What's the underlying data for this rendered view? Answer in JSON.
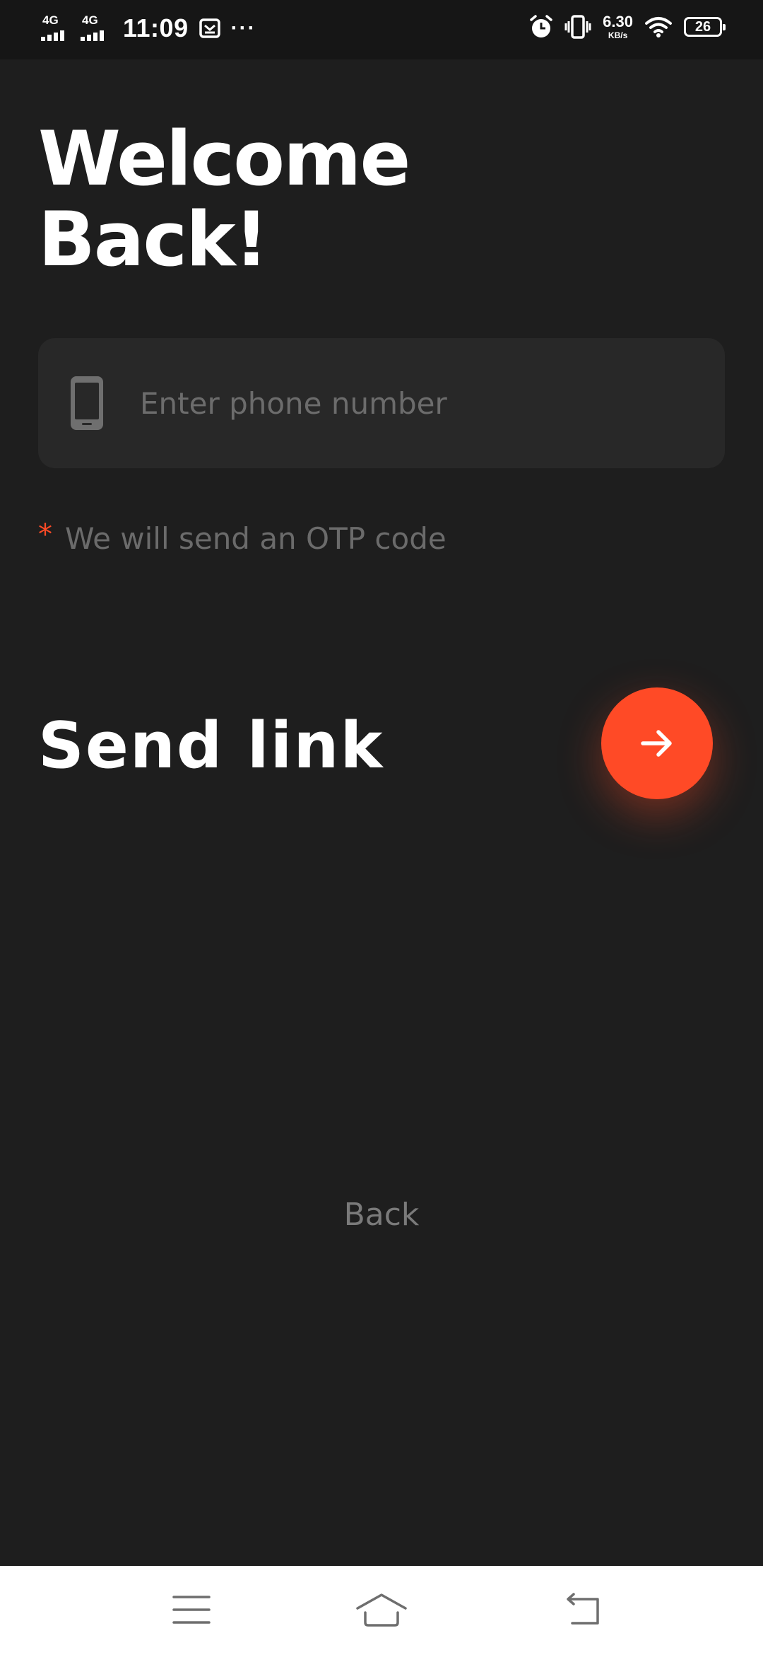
{
  "status_bar": {
    "network_1": "4G",
    "network_2": "4G",
    "time": "11:09",
    "more": "···",
    "speed_value": "6.30",
    "speed_unit": "KB/s",
    "battery_level": "26"
  },
  "login": {
    "title_line_1": "Welcome",
    "title_line_2": "Back!",
    "phone_placeholder": "Enter phone number",
    "hint_marker": "*",
    "hint_text": "We will send an OTP code",
    "send_label": "Send link",
    "back_label": "Back"
  },
  "colors": {
    "background": "#1e1e1e",
    "field_background": "#282828",
    "accent": "#ff4a26",
    "muted_text": "#6b6b6b"
  },
  "icons": {
    "phone_field": "smartphone-icon",
    "send_button": "arrow-right-icon",
    "nav_menu": "menu-icon",
    "nav_home": "home-icon",
    "nav_back": "back-icon"
  }
}
